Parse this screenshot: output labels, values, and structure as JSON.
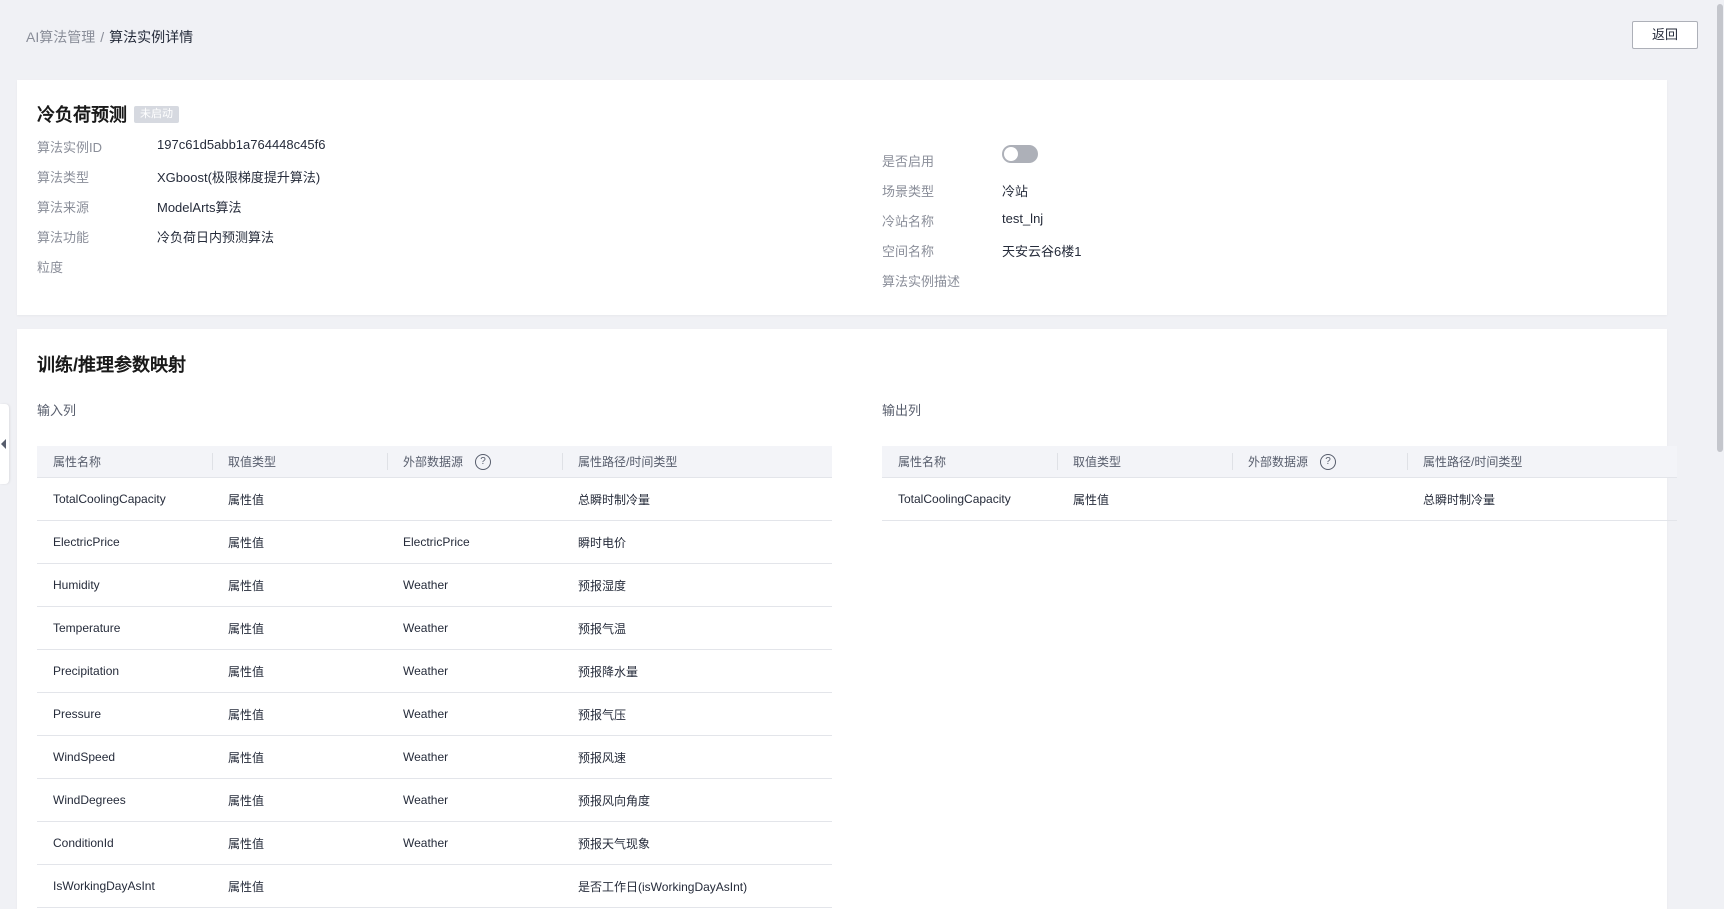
{
  "breadcrumb": {
    "parent": "AI算法管理",
    "separator": "/",
    "current": "算法实例详情"
  },
  "header": {
    "back_label": "返回"
  },
  "instance": {
    "title": "冷负荷预测",
    "status": "未启动",
    "left": [
      {
        "label": "算法实例ID",
        "value": "197c61d5abb1a764448c45f6"
      },
      {
        "label": "算法类型",
        "value": "XGboost(极限梯度提升算法)"
      },
      {
        "label": "算法来源",
        "value": "ModelArts算法"
      },
      {
        "label": "算法功能",
        "value": "冷负荷日内预测算法"
      },
      {
        "label": "粒度",
        "value": ""
      }
    ],
    "right": [
      {
        "label": "是否启用",
        "value": ""
      },
      {
        "label": "场景类型",
        "value": "冷站"
      },
      {
        "label": "冷站名称",
        "value": "test_lnj"
      },
      {
        "label": "空间名称",
        "value": "天安云谷6楼1"
      },
      {
        "label": "算法实例描述",
        "value": ""
      }
    ],
    "enabled": false
  },
  "mapping": {
    "title": "训练/推理参数映射",
    "input_label": "输入列",
    "output_label": "输出列",
    "columns": [
      "属性名称",
      "取值类型",
      "外部数据源",
      "属性路径/时间类型"
    ],
    "help_glyph": "?",
    "input_rows": [
      [
        "TotalCoolingCapacity",
        "属性值",
        "",
        "总瞬时制冷量"
      ],
      [
        "ElectricPrice",
        "属性值",
        "ElectricPrice",
        "瞬时电价"
      ],
      [
        "Humidity",
        "属性值",
        "Weather",
        "预报湿度"
      ],
      [
        "Temperature",
        "属性值",
        "Weather",
        "预报气温"
      ],
      [
        "Precipitation",
        "属性值",
        "Weather",
        "预报降水量"
      ],
      [
        "Pressure",
        "属性值",
        "Weather",
        "预报气压"
      ],
      [
        "WindSpeed",
        "属性值",
        "Weather",
        "预报风速"
      ],
      [
        "WindDegrees",
        "属性值",
        "Weather",
        "预报风向角度"
      ],
      [
        "ConditionId",
        "属性值",
        "Weather",
        "预报天气现象"
      ],
      [
        "IsWorkingDayAsInt",
        "属性值",
        "",
        "是否工作日(isWorkingDayAsInt)"
      ]
    ],
    "output_rows": [
      [
        "TotalCoolingCapacity",
        "属性值",
        "",
        "总瞬时制冷量"
      ]
    ]
  },
  "colors": {
    "page_bg": "#f0f1f5",
    "card_bg": "#ffffff",
    "label": "#8a8e99",
    "text": "#252b3a",
    "header_bg": "#f3f4f8"
  }
}
